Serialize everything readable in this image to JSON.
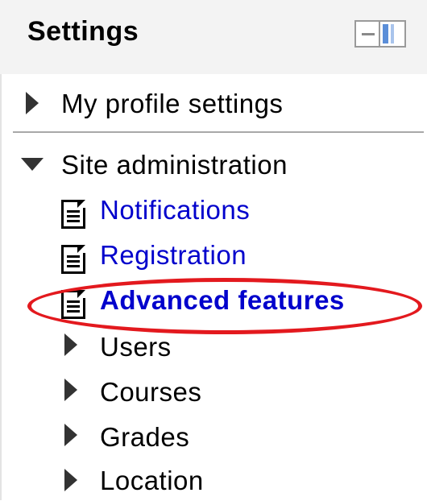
{
  "block": {
    "title": "Settings",
    "controls": {
      "collapse_icon": "minus-box-icon",
      "dock_icon": "dock-panel-icon"
    }
  },
  "tree": {
    "my_profile": {
      "label": "My profile settings",
      "expanded": false
    },
    "site_admin": {
      "label": "Site administration",
      "expanded": true,
      "pages": [
        {
          "label": "Notifications",
          "icon": "document-icon"
        },
        {
          "label": "Registration",
          "icon": "document-icon"
        },
        {
          "label": "Advanced features",
          "icon": "document-icon",
          "highlighted": true
        }
      ],
      "categories": [
        {
          "label": "Users",
          "expanded": false
        },
        {
          "label": "Courses",
          "expanded": false
        },
        {
          "label": "Grades",
          "expanded": false
        },
        {
          "label": "Location",
          "expanded": false
        }
      ]
    }
  },
  "colors": {
    "link": "#0000cc",
    "highlight_ellipse": "#e3191e",
    "header_bg": "#f3f3f3"
  }
}
